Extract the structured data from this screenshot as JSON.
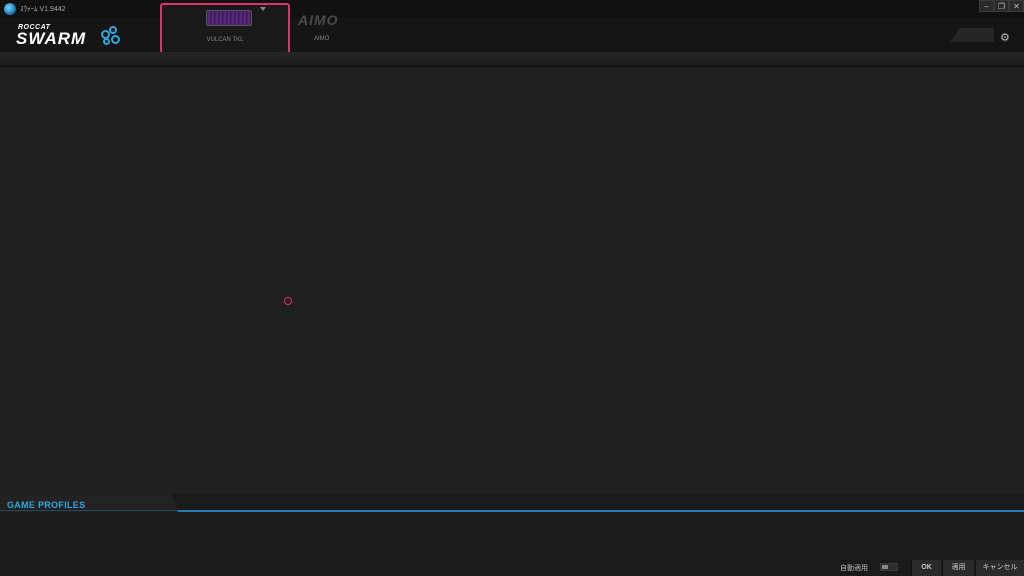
{
  "titlebar": {
    "title": "ｽｳｫｰﾑ V1.9442",
    "minimize": "–",
    "restore": "❐",
    "close": "✕"
  },
  "brand": {
    "small": "ROCCAT",
    "large": "SWARM"
  },
  "devices": [
    {
      "label": "VULCAN TKL",
      "selected": true
    },
    {
      "label": "AIMO",
      "logo": "AIMO",
      "selected": false
    }
  ],
  "header": {
    "settings_icon": "⚙"
  },
  "game_profiles": {
    "title": "GAME PROFILES"
  },
  "footer": {
    "auto_apply_label": "自動適用",
    "ok": "OK",
    "apply": "適用",
    "cancel": "キャンセル"
  },
  "colors": {
    "accent": "#2fa8e0",
    "highlight": "#e0306a",
    "background": "#1f1f1f"
  }
}
